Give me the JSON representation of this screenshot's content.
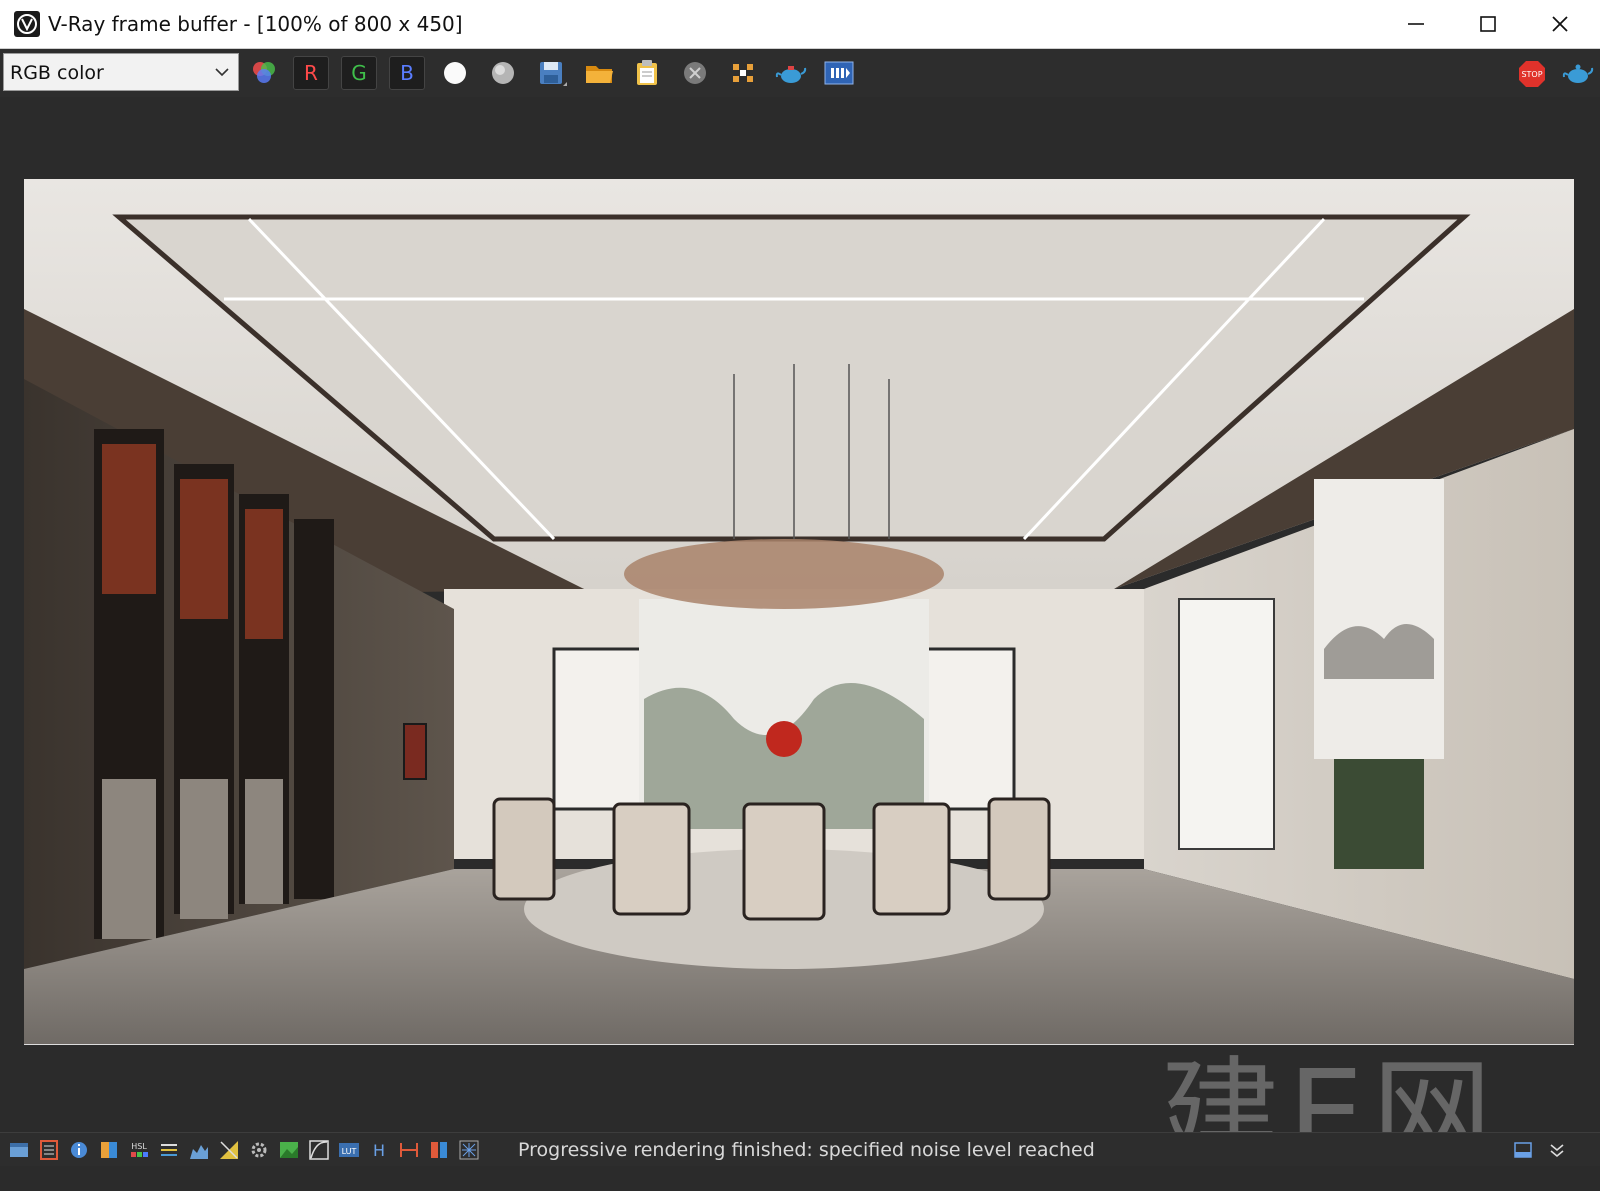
{
  "window": {
    "title": "V-Ray frame buffer - [100% of 800 x 450]"
  },
  "toolbar": {
    "channel_value": "RGB color",
    "red_label": "R",
    "green_label": "G",
    "blue_label": "B"
  },
  "statusbar": {
    "message": "Progressive rendering finished: specified noise level reached",
    "h_label": "H",
    "lut_label": "LUT",
    "hsl_label": "HSL"
  },
  "render": {
    "watermark": "建E网"
  },
  "colors": {
    "stop": "#e0322b",
    "teapot": "#3a9bd6",
    "folder": "#f0a21a"
  }
}
